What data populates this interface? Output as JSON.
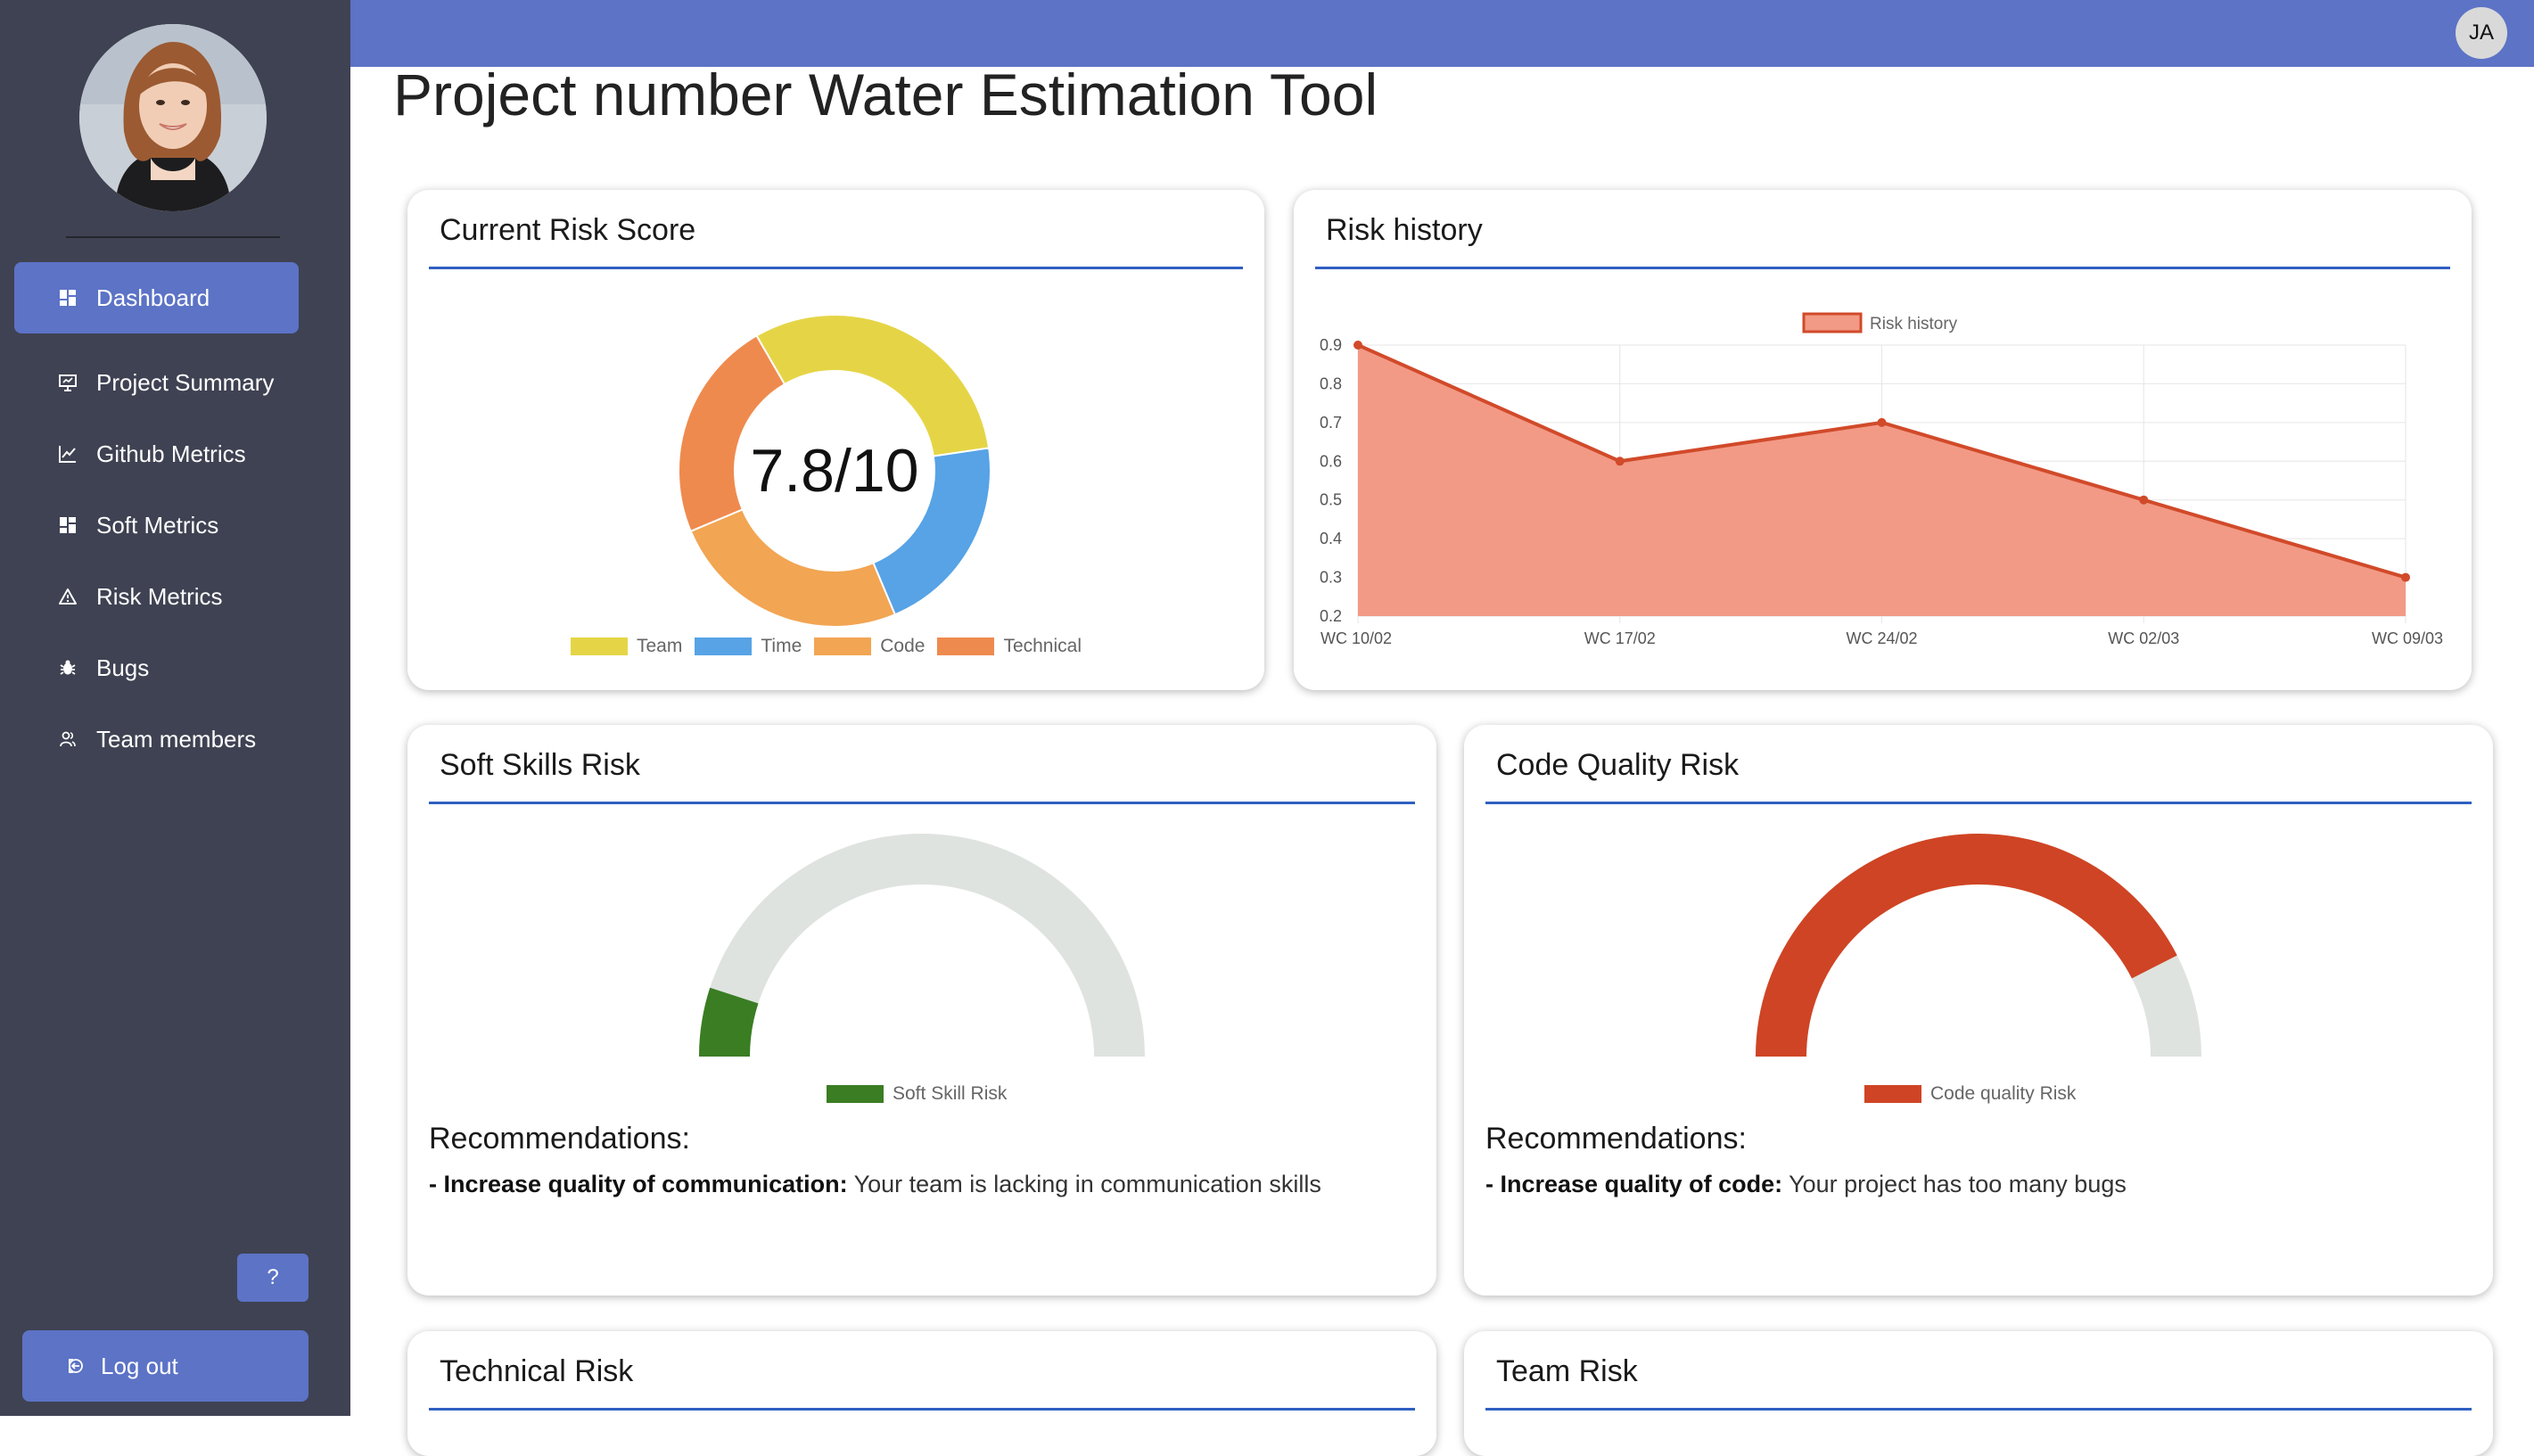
{
  "user": {
    "initials": "JA"
  },
  "page": {
    "title": "Project number Water Estimation Tool"
  },
  "sidebar": {
    "items": [
      {
        "label": "Dashboard",
        "icon": "dashboard-icon",
        "active": true
      },
      {
        "label": "Project Summary",
        "icon": "presentation-icon"
      },
      {
        "label": "Github Metrics",
        "icon": "line-chart-icon"
      },
      {
        "label": "Soft Metrics",
        "icon": "grid-icon"
      },
      {
        "label": "Risk Metrics",
        "icon": "warning-triangle-icon"
      },
      {
        "label": "Bugs",
        "icon": "bug-icon"
      },
      {
        "label": "Team members",
        "icon": "people-icon"
      }
    ],
    "help_label": "?",
    "logout_label": "Log out"
  },
  "cards": {
    "current_risk": {
      "title": "Current Risk Score",
      "score_text": "7.8/10",
      "legend": [
        "Team",
        "Time",
        "Code",
        "Technical"
      ]
    },
    "risk_history": {
      "title": "Risk history"
    },
    "soft_skills": {
      "title": "Soft Skills Risk",
      "legend": "Soft Skill Risk",
      "rec_title": "Recommendations:",
      "rec_bold": "- Increase quality of communication:",
      "rec_text": " Your team is lacking in communication skills"
    },
    "code_quality": {
      "title": "Code Quality Risk",
      "legend": "Code quality Risk",
      "rec_title": "Recommendations:",
      "rec_bold": "- Increase quality of code:",
      "rec_text": " Your project has too many bugs"
    },
    "technical": {
      "title": "Technical Risk"
    },
    "team": {
      "title": "Team Risk"
    }
  },
  "colors": {
    "accent": "#5c73c6",
    "sidebar": "#3f4252",
    "team": "#e5d546",
    "time": "#57a3e6",
    "code": "#f2a553",
    "technical": "#ef8a4e",
    "history_fill": "#f29a86",
    "history_line": "#d14a2a",
    "soft_skill": "#3a7d23",
    "code_quality": "#cf4424",
    "gauge_track": "#dfe3df"
  },
  "chart_data": [
    {
      "type": "pie",
      "variant": "doughnut",
      "title": "Current Risk Score",
      "categories": [
        "Team",
        "Time",
        "Code",
        "Technical"
      ],
      "values": [
        31,
        21,
        25,
        23
      ],
      "center_label": "7.8/10"
    },
    {
      "type": "area",
      "title": "Risk history",
      "categories": [
        "WC 10/02",
        "WC 17/02",
        "WC 24/02",
        "WC 02/03",
        "WC 09/03"
      ],
      "series": [
        {
          "name": "Risk history",
          "values": [
            0.9,
            0.6,
            0.7,
            0.5,
            0.3
          ]
        }
      ],
      "ylim": [
        0.2,
        0.9
      ],
      "yticks": [
        "0.9",
        "0.8",
        "0.7",
        "0.6",
        "0.5",
        "0.4",
        "0.3",
        "0.2"
      ],
      "grid": true,
      "legend": "top-center"
    },
    {
      "type": "pie",
      "variant": "half-doughnut gauge",
      "title": "Soft Skills Risk",
      "categories": [
        "Soft Skill Risk"
      ],
      "values": [
        0.1
      ]
    },
    {
      "type": "pie",
      "variant": "half-doughnut gauge",
      "title": "Code Quality Risk",
      "categories": [
        "Code quality Risk"
      ],
      "values": [
        0.85
      ]
    }
  ]
}
